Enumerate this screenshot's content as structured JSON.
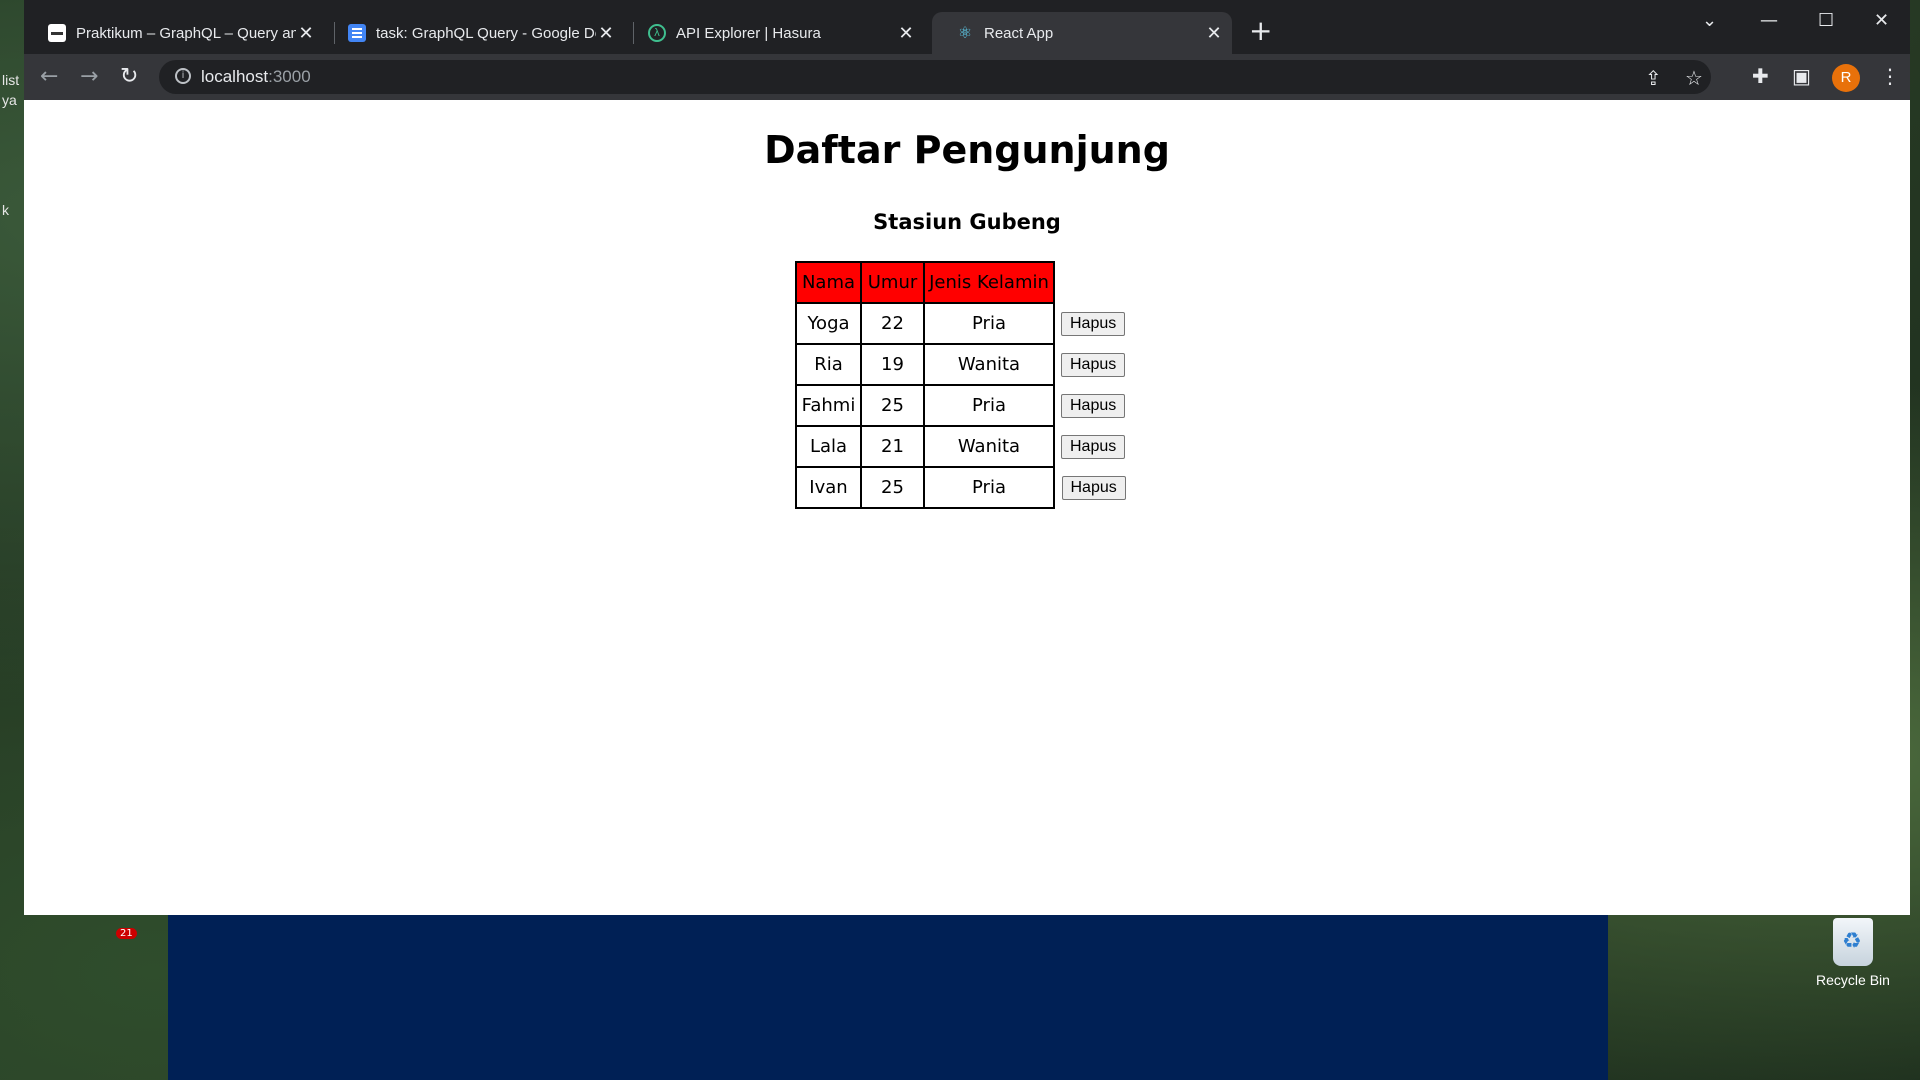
{
  "desktop": {
    "left_text": [
      "list",
      "ya",
      "k"
    ],
    "recycle_bin_label": "Recycle Bin",
    "badge_count": "21"
  },
  "browser": {
    "tabs": [
      {
        "title": "Praktikum – GraphQL – Query an",
        "icon": "page-favicon"
      },
      {
        "title": "task: GraphQL Query - Google Do",
        "icon": "google-docs-icon"
      },
      {
        "title": "API Explorer | Hasura",
        "icon": "hasura-icon"
      },
      {
        "title": "React App",
        "icon": "react-icon",
        "active": true
      }
    ],
    "url_host": "localhost",
    "url_port": ":3000",
    "profile_initial": "R"
  },
  "page": {
    "title": "Daftar Pengunjung",
    "subtitle": "Stasiun Gubeng",
    "table": {
      "headers": [
        "Nama",
        "Umur",
        "Jenis Kelamin"
      ],
      "rows": [
        {
          "nama": "Yoga",
          "umur": "22",
          "jk": "Pria"
        },
        {
          "nama": "Ria",
          "umur": "19",
          "jk": "Wanita"
        },
        {
          "nama": "Fahmi",
          "umur": "25",
          "jk": "Pria"
        },
        {
          "nama": "Lala",
          "umur": "21",
          "jk": "Wanita"
        },
        {
          "nama": "Ivan",
          "umur": "25",
          "jk": "Pria"
        }
      ],
      "delete_label": "Hapus",
      "header_color": "#ff0000"
    }
  }
}
